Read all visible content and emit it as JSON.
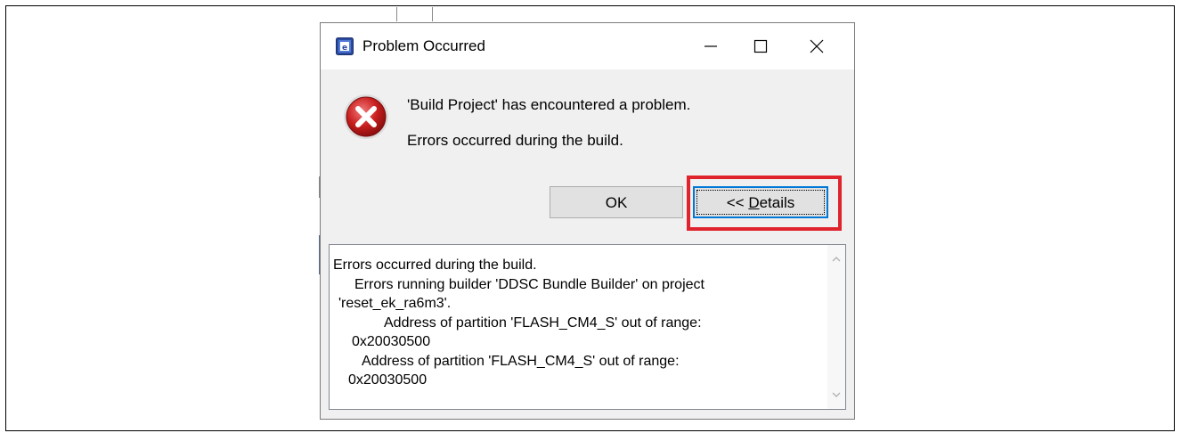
{
  "dialog": {
    "title": "Problem Occurred",
    "message": "'Build Project' has encountered a problem.",
    "submessage": "Errors occurred during the build.",
    "ok_label": "OK",
    "details_prefix": "<< ",
    "details_mnemonic": "D",
    "details_rest": "etails",
    "icons": {
      "app": "eclipse-e2studio-icon",
      "error": "error-icon",
      "minimize": "minimize-icon",
      "maximize": "maximize-icon",
      "close": "close-icon"
    },
    "highlight_color": "#e0242e"
  },
  "details": {
    "lines": [
      "Errors occurred during the build.",
      "Errors running builder 'DDSC Bundle Builder' on project",
      "'reset_ek_ra6m3'.",
      "Address of partition 'FLASH_CM4_S' out of range:",
      "0x20030500",
      "Address of partition 'FLASH_CM4_S' out of range:",
      "0x20030500"
    ]
  }
}
